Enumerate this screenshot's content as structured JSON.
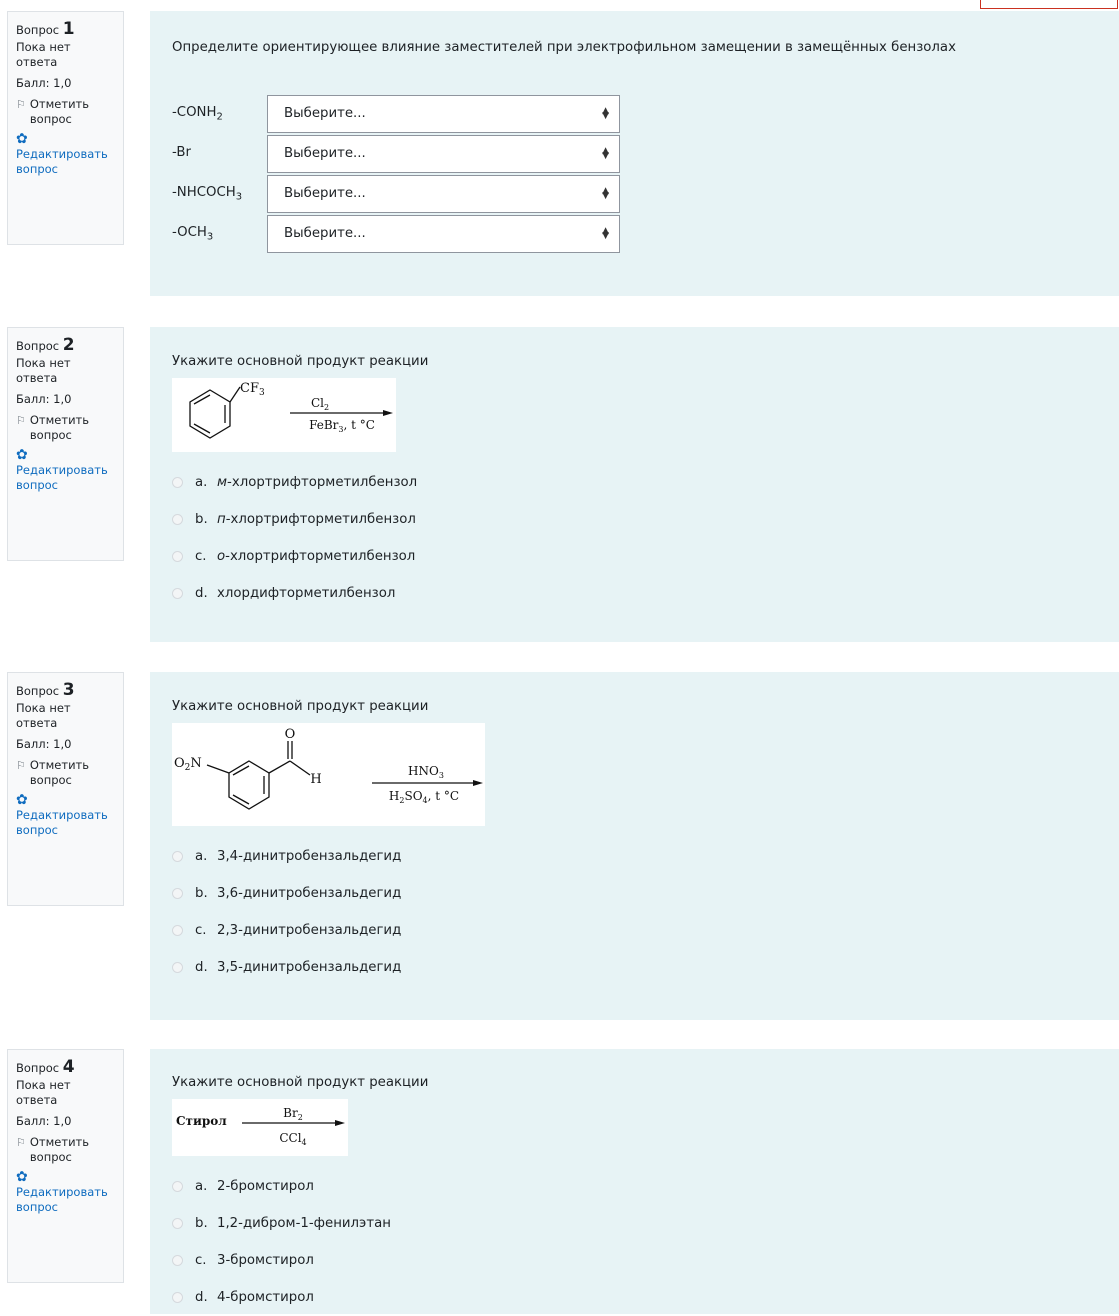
{
  "labels": {
    "question_word": "Вопрос",
    "state": "Пока нет ответа",
    "grade": "Балл: 1,0",
    "flag": "Отметить вопрос",
    "edit": "Редактировать вопрос",
    "select_placeholder": "Выберите..."
  },
  "colors": {
    "accent": "#0f6cbf",
    "content_bg": "#e7f3f5",
    "info_bg": "#f8f9fa"
  },
  "questions": [
    {
      "number": "1",
      "text": "Определите ориентирующее влияние заместителей при электрофильном замещении в замещённых бензолах",
      "match_rows": [
        {
          "prefix": "-CONH",
          "sub": "2",
          "suffix": "",
          "value": "Выберите..."
        },
        {
          "prefix": "-Br",
          "sub": "",
          "suffix": "",
          "value": "Выберите..."
        },
        {
          "prefix": "-NHCOCH",
          "sub": "3",
          "suffix": "",
          "value": "Выберите..."
        },
        {
          "prefix": "-OCH",
          "sub": "3",
          "suffix": "",
          "value": "Выберите..."
        }
      ]
    },
    {
      "number": "2",
      "text": "Укажите основной продукт реакции",
      "reaction": {
        "substituent": "CF3",
        "reagent_top": "Cl2",
        "reagent_bottom": "FeBr3, t °C"
      },
      "options": [
        {
          "letter": "a.",
          "prefix": "м",
          "rest": "-хлортрифторметилбензол"
        },
        {
          "letter": "b.",
          "prefix": "п",
          "rest": "-хлортрифторметилбензол"
        },
        {
          "letter": "c.",
          "prefix": "о",
          "rest": "-хлортрифторметилбензол"
        },
        {
          "letter": "d.",
          "prefix": "",
          "rest": "хлордифторметилбензол"
        }
      ]
    },
    {
      "number": "3",
      "text": "Укажите основной продукт реакции",
      "reaction": {
        "substituent": "O2N",
        "aldehyde_o": "O",
        "aldehyde_h": "H",
        "reagent_top": "HNO3",
        "reagent_bottom": "H2SO4, t °C"
      },
      "options": [
        {
          "letter": "a.",
          "prefix": "",
          "rest": "3,4-динитробензальдегид"
        },
        {
          "letter": "b.",
          "prefix": "",
          "rest": "3,6-динитробензальдегид"
        },
        {
          "letter": "c.",
          "prefix": "",
          "rest": "2,3-динитробензальдегид"
        },
        {
          "letter": "d.",
          "prefix": "",
          "rest": "3,5-динитробензальдегид"
        }
      ]
    },
    {
      "number": "4",
      "text": "Укажите основной продукт реакции",
      "reaction": {
        "reactant": "Стирол",
        "reagent_top": "Br2",
        "reagent_bottom": "CCl4"
      },
      "options": [
        {
          "letter": "a.",
          "prefix": "",
          "rest": "2-бромстирол"
        },
        {
          "letter": "b.",
          "prefix": "",
          "rest": "1,2-дибром-1-фенилэтан"
        },
        {
          "letter": "c.",
          "prefix": "",
          "rest": "3-бромстирол"
        },
        {
          "letter": "d.",
          "prefix": "",
          "rest": "4-бромстирол"
        }
      ]
    }
  ]
}
